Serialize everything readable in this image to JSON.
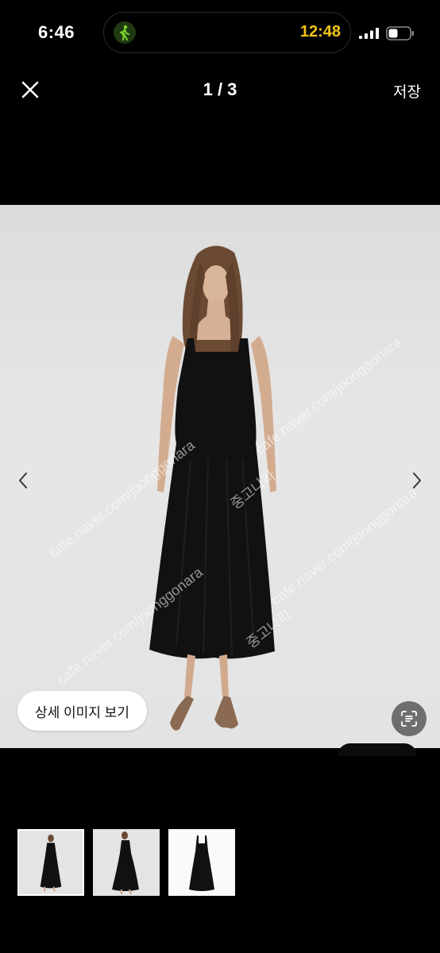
{
  "status_bar": {
    "time": "6:46",
    "activity_time": "12:48"
  },
  "nav": {
    "counter": "1 / 3",
    "save_label": "저장"
  },
  "photo": {
    "detail_button_label": "상세 이미지 보기",
    "watermarks": [
      "cafe.naver.com/joonggonara",
      "중고나라",
      "cafe.naver.com/joonggonara",
      "중고나라",
      "cafe.naver.com/joonggonara",
      "cafe.naver.com/joonggonara"
    ]
  },
  "thumbnails": [
    {
      "name": "front view",
      "selected": true
    },
    {
      "name": "side view",
      "selected": false
    },
    {
      "name": "flat dress",
      "selected": false
    }
  ],
  "colors": {
    "background": "#000000",
    "photo_bg": "#e0e0e0",
    "accent_time": "#f2c418",
    "walk_green": "#7bd02b"
  }
}
